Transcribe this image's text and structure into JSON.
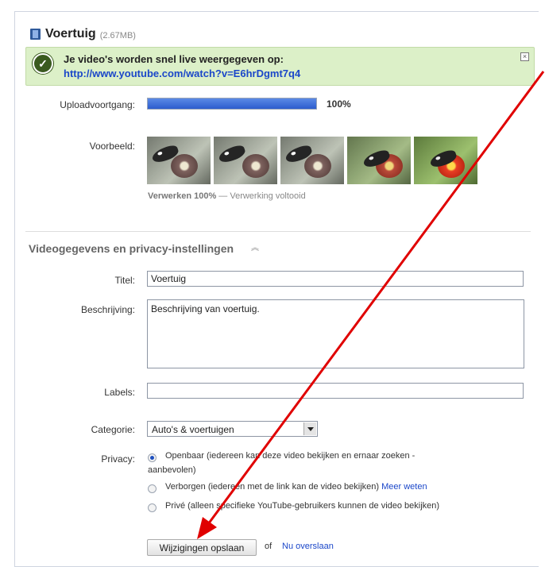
{
  "header": {
    "title": "Voertuig",
    "size": "(2.67MB)"
  },
  "banner": {
    "message": "Je video's worden snel live weergegeven op:",
    "link": "http://www.youtube.com/watch?v=E6hrDgmt7q4",
    "close_icon": "close-icon"
  },
  "upload": {
    "label": "Uploadvoortgang:",
    "progress_percent": 100,
    "progress_text": "100%"
  },
  "preview": {
    "label": "Voorbeeld:",
    "thumbnails": [
      {
        "name": "thumbnail-1",
        "style": "dim"
      },
      {
        "name": "thumbnail-2",
        "style": "dim"
      },
      {
        "name": "thumbnail-3",
        "style": "dim"
      },
      {
        "name": "thumbnail-4",
        "style": "half"
      },
      {
        "name": "thumbnail-5",
        "style": "normal"
      }
    ],
    "processing_bold": "Verwerken 100%",
    "processing_rest": " — Verwerking voltooid"
  },
  "section": {
    "title": "Videogegevens en privacy-instellingen"
  },
  "form": {
    "title_label": "Titel:",
    "title_value": "Voertuig",
    "description_label": "Beschrijving:",
    "description_value": "Beschrijving van voertuig.",
    "labels_label": "Labels:",
    "labels_value": "",
    "category_label": "Categorie:",
    "category_value": "Auto's & voertuigen",
    "privacy_label": "Privacy:",
    "privacy_options": [
      {
        "text": "Openbaar (iedereen kan deze video bekijken en ernaar zoeken -",
        "text2": "aanbevolen)",
        "selected": true
      },
      {
        "text": "Verborgen (iedereen met de link kan de video bekijken) ",
        "link": "Meer weten",
        "selected": false
      },
      {
        "text": "Privé (alleen specifieke YouTube-gebruikers kunnen de video bekijken)",
        "selected": false
      }
    ]
  },
  "actions": {
    "save_label": "Wijzigingen opslaan",
    "or_text": "of",
    "skip_link": "Nu overslaan"
  },
  "colors": {
    "accent_link": "#1b47c9",
    "banner_bg": "#dcf0c8",
    "progress": "#2c5ccd",
    "arrow": "#e00000"
  }
}
